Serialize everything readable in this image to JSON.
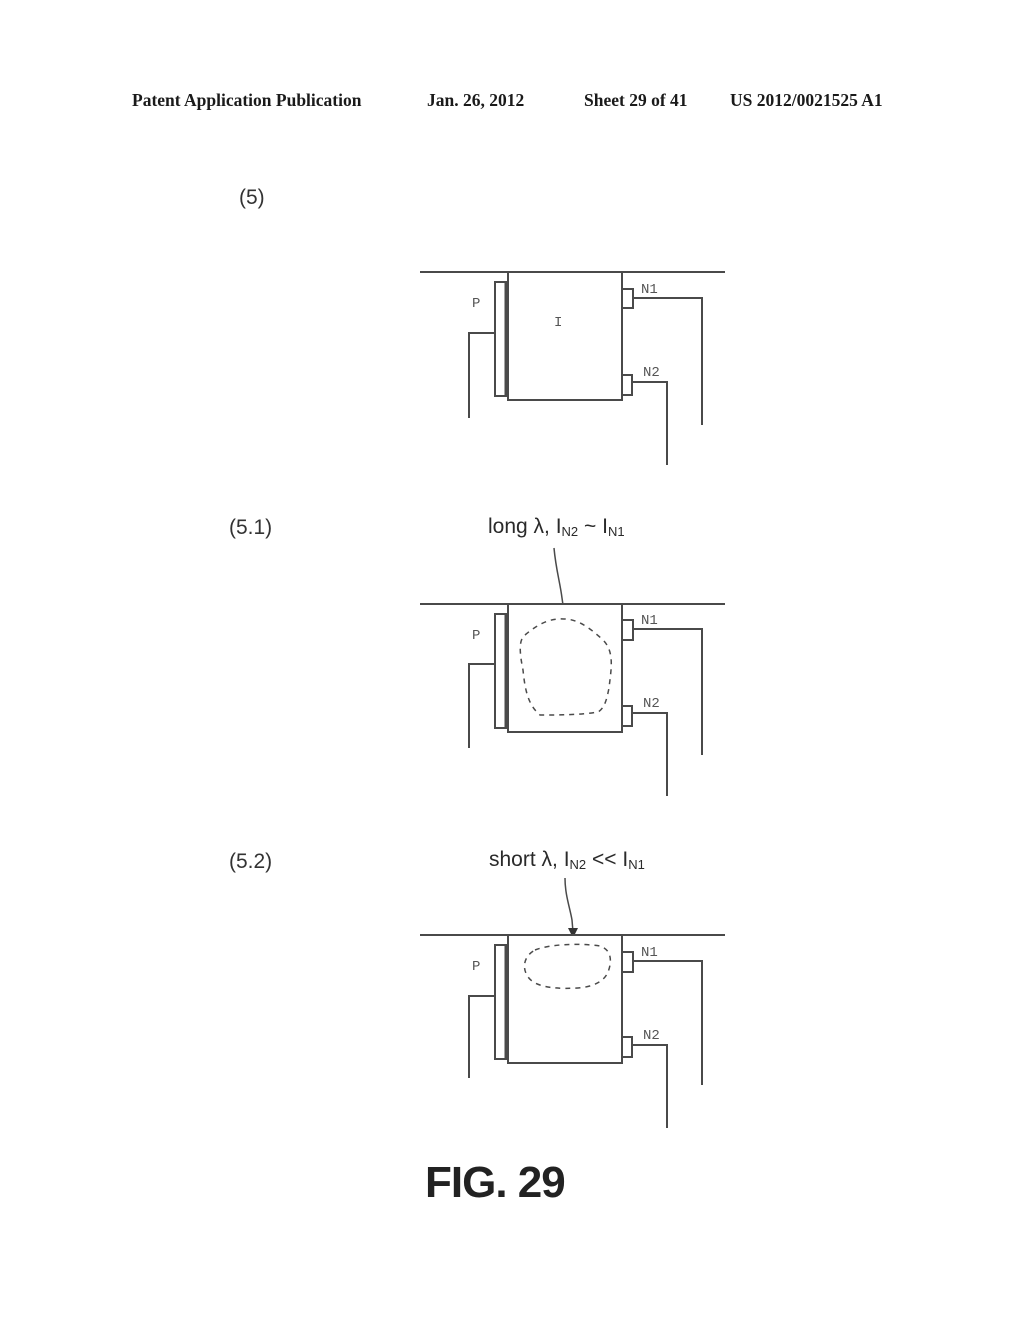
{
  "header": {
    "publication": "Patent Application Publication",
    "date": "Jan. 26, 2012",
    "sheet": "Sheet 29 of 41",
    "number": "US 2012/0021525 A1"
  },
  "panels": [
    {
      "label": "(5)",
      "caption": null,
      "center_label": "I",
      "p_label": "P",
      "n1_label": "N1",
      "n2_label": "N2",
      "region": "none"
    },
    {
      "label": "(5.1)",
      "caption": {
        "prefix": "long λ, I",
        "sub1": "N2",
        "mid": " ~ I",
        "sub2": "N1"
      },
      "p_label": "P",
      "n1_label": "N1",
      "n2_label": "N2",
      "region": "large"
    },
    {
      "label": "(5.2)",
      "caption": {
        "prefix": "short λ, I",
        "sub1": "N2",
        "mid": " << I",
        "sub2": "N1"
      },
      "p_label": "P",
      "n1_label": "N1",
      "n2_label": "N2",
      "region": "small"
    }
  ],
  "figure_title": "FIG. 29",
  "colors": {
    "line": "#4a4a4a",
    "text": "#222222"
  }
}
